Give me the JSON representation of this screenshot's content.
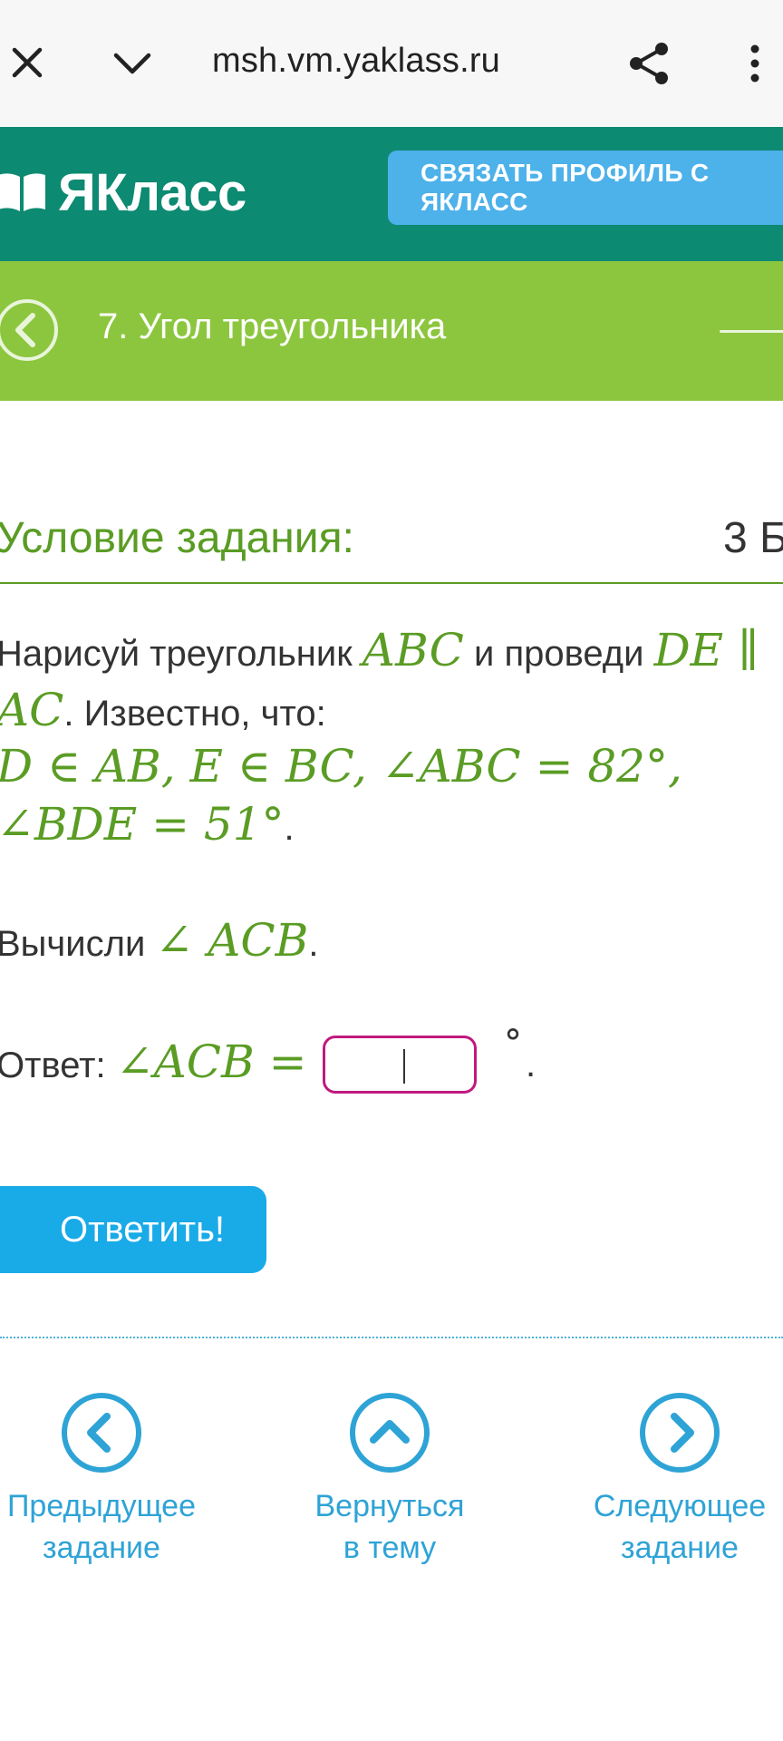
{
  "browser": {
    "url": "msh.vm.yaklass.ru"
  },
  "header": {
    "logo_text": "ЯКласс",
    "connect_button": "СВЯЗАТЬ ПРОФИЛЬ С ЯКЛАСС"
  },
  "topic": {
    "title": "7. Угол треугольника"
  },
  "task": {
    "heading": "Условие задания:",
    "points": "3 Б.",
    "line1_a": "Нарисуй треугольник ",
    "line1_m1": "ABC",
    "line1_b": " и проведи ",
    "line1_m2": "DE ∥",
    "line2_m": "AC",
    "line2_b": ". Известно, что:",
    "line3_m": "D ∈ AB, E ∈ BC, ∠ABC = 82°,",
    "line4_m": "∠BDE = 51°",
    "line4_b": ".",
    "line5_a": "Вычисли ",
    "line5_m": "∠ ACB",
    "line5_b": ".",
    "answer_label": "Ответ: ",
    "answer_math": "∠ACB =",
    "answer_value": "",
    "answer_suffix": "°",
    "answer_dot": ".",
    "submit": "Ответить!"
  },
  "nav": {
    "prev": "Предыдущее\nзадание",
    "up": "Вернуться\nв тему",
    "next": "Следующее\nзадание"
  },
  "colors": {
    "header_bg": "#0d8a72",
    "topic_bg": "#8cc63e",
    "accent_green": "#5a9c24",
    "button_blue": "#19aae8",
    "input_border": "#c0197e",
    "link_blue": "#2ea3d6"
  }
}
